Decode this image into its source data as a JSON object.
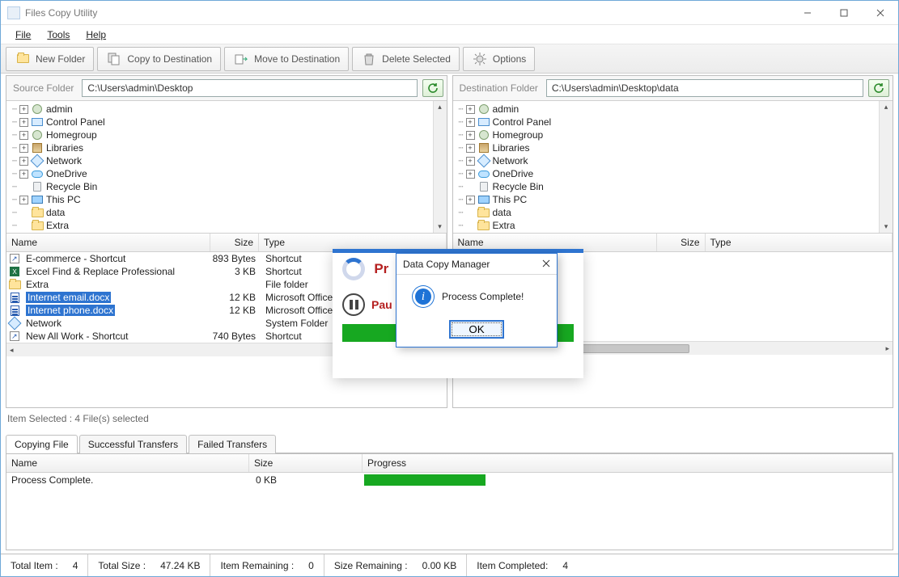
{
  "window": {
    "title": "Files Copy Utility"
  },
  "menu": {
    "file": "File",
    "tools": "Tools",
    "help": "Help"
  },
  "toolbar": {
    "new_folder": "New Folder",
    "copy_dest": "Copy to Destination",
    "move_dest": "Move to Destination",
    "delete_sel": "Delete Selected",
    "options": "Options"
  },
  "source": {
    "label": "Source Folder",
    "path": "C:\\Users\\admin\\Desktop",
    "tree": [
      {
        "exp": "+",
        "icon": "user",
        "label": "admin"
      },
      {
        "exp": "+",
        "icon": "cp",
        "label": "Control Panel"
      },
      {
        "exp": "+",
        "icon": "user",
        "label": "Homegroup"
      },
      {
        "exp": "+",
        "icon": "lib",
        "label": "Libraries"
      },
      {
        "exp": "+",
        "icon": "net",
        "label": "Network"
      },
      {
        "exp": "+",
        "icon": "cloud",
        "label": "OneDrive"
      },
      {
        "exp": "",
        "icon": "bin",
        "label": "Recycle Bin"
      },
      {
        "exp": "+",
        "icon": "pc",
        "label": "This PC"
      },
      {
        "exp": "",
        "icon": "folder",
        "label": "data"
      },
      {
        "exp": "",
        "icon": "folder",
        "label": "Extra"
      }
    ],
    "columns": {
      "name": "Name",
      "size": "Size",
      "type": "Type"
    },
    "rows": [
      {
        "icon": "short",
        "name": "E-commerce - Shortcut",
        "size": "893 Bytes",
        "type": "Shortcut",
        "sel": false
      },
      {
        "icon": "xl",
        "name": "Excel Find & Replace Professional",
        "size": "3 KB",
        "type": "Shortcut",
        "sel": false
      },
      {
        "icon": "folder",
        "name": "Extra",
        "size": "",
        "type": "File folder",
        "sel": false
      },
      {
        "icon": "doc",
        "name": "Internet email.docx",
        "size": "12 KB",
        "type": "Microsoft Office",
        "sel": true
      },
      {
        "icon": "doc",
        "name": "Internet phone.docx",
        "size": "12 KB",
        "type": "Microsoft Office",
        "sel": true
      },
      {
        "icon": "net",
        "name": "Network",
        "size": "",
        "type": "System Folder",
        "sel": false
      },
      {
        "icon": "short",
        "name": "New All Work - Shortcut",
        "size": "740 Bytes",
        "type": "Shortcut",
        "sel": false
      }
    ]
  },
  "dest": {
    "label": "Destination Folder",
    "path": "C:\\Users\\admin\\Desktop\\data",
    "tree": [
      {
        "exp": "+",
        "icon": "user",
        "label": "admin"
      },
      {
        "exp": "+",
        "icon": "cp",
        "label": "Control Panel"
      },
      {
        "exp": "+",
        "icon": "user",
        "label": "Homegroup"
      },
      {
        "exp": "+",
        "icon": "lib",
        "label": "Libraries"
      },
      {
        "exp": "+",
        "icon": "net",
        "label": "Network"
      },
      {
        "exp": "+",
        "icon": "cloud",
        "label": "OneDrive"
      },
      {
        "exp": "",
        "icon": "bin",
        "label": "Recycle Bin"
      },
      {
        "exp": "+",
        "icon": "pc",
        "label": "This PC"
      },
      {
        "exp": "",
        "icon": "folder",
        "label": "data"
      },
      {
        "exp": "",
        "icon": "folder",
        "label": "Extra"
      }
    ],
    "columns": {
      "name": "Name",
      "size": "Size",
      "type": "Type"
    }
  },
  "selection_status": "Item Selected :  4 File(s) selected",
  "proc_banner": {
    "title_prefix": "Pr",
    "pause": "Pau"
  },
  "modal": {
    "title": "Data Copy Manager",
    "message": "Process Complete!",
    "ok": "OK"
  },
  "tabs": {
    "copying": "Copying File",
    "success": "Successful Transfers",
    "failed": "Failed Transfers"
  },
  "copy_table": {
    "cols": {
      "name": "Name",
      "size": "Size",
      "progress": "Progress"
    },
    "row": {
      "name": "Process Complete.",
      "size": "0 KB"
    }
  },
  "status": {
    "total_item_lbl": "Total Item :",
    "total_item": "4",
    "total_size_lbl": "Total Size :",
    "total_size": "47.24 KB",
    "item_rem_lbl": "Item Remaining :",
    "item_rem": "0",
    "size_rem_lbl": "Size Remaining :",
    "size_rem": "0.00 KB",
    "item_comp_lbl": "Item Completed:",
    "item_comp": "4"
  }
}
